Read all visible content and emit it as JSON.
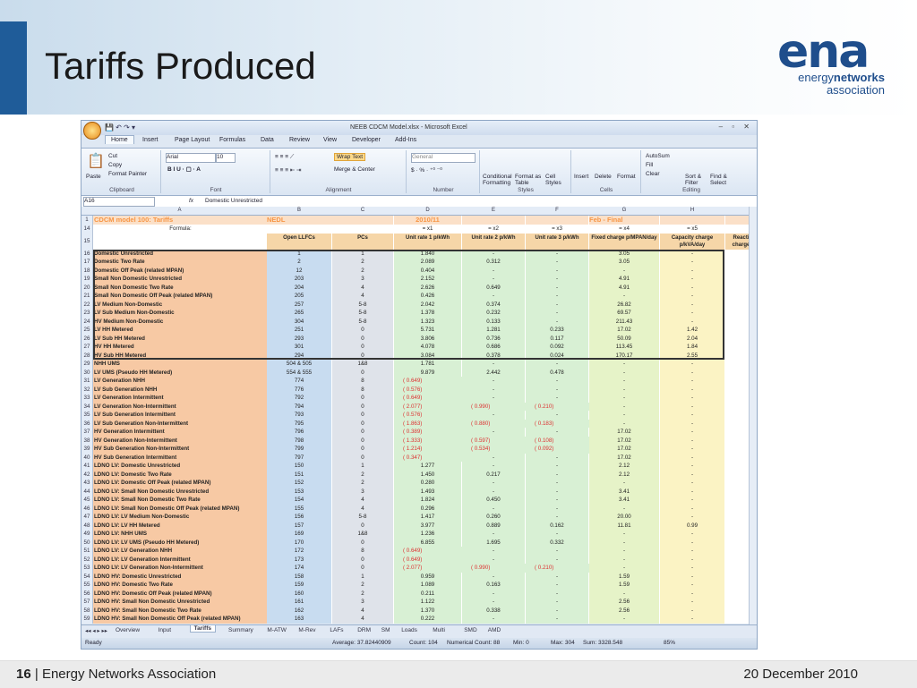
{
  "slide": {
    "title": "Tariffs Produced",
    "logo_big": "ena",
    "logo_line1a": "energy",
    "logo_line1b": "networks",
    "logo_line2": "association",
    "footer_page": "16",
    "footer_sep": "|",
    "footer_org": "Energy Networks Association",
    "footer_date": "20 December 2010"
  },
  "excel": {
    "window_title": "NEEB CDCM Model.xlsx - Microsoft Excel",
    "tabs": [
      "Home",
      "Insert",
      "Page Layout",
      "Formulas",
      "Data",
      "Review",
      "View",
      "Developer",
      "Add-Ins"
    ],
    "ribbon": {
      "clipboard": {
        "paste": "Paste",
        "cut": "Cut",
        "copy": "Copy",
        "format_painter": "Format Painter",
        "label": "Clipboard"
      },
      "font": {
        "name": "Arial",
        "size": "10",
        "label": "Font"
      },
      "alignment": {
        "wrap": "Wrap Text",
        "merge": "Merge & Center",
        "label": "Alignment"
      },
      "number": {
        "format": "General",
        "label": "Number"
      },
      "styles": {
        "cond": "Conditional Formatting",
        "table": "Format as Table",
        "cell": "Cell Styles",
        "label": "Styles"
      },
      "cells": {
        "insert": "Insert",
        "delete": "Delete",
        "format": "Format",
        "label": "Cells"
      },
      "editing": {
        "autosum": "AutoSum",
        "fill": "Fill",
        "clear": "Clear",
        "sort": "Sort & Filter",
        "find": "Find & Select",
        "label": "Editing"
      }
    },
    "name_box": "A16",
    "fx": "fx",
    "formula_value": "Domestic Unrestricted",
    "col_letters": [
      "A",
      "B",
      "C",
      "D",
      "E",
      "F",
      "G",
      "H"
    ],
    "header_row1": {
      "a": "CDCM model 100: Tariffs",
      "b": "NEDL",
      "d": "2010/11",
      "g": "Feb - Final"
    },
    "header_row14": {
      "a": "Formula:",
      "d": "= x1",
      "e": "= x2",
      "f": "= x3",
      "g": "= x4",
      "h": "= x5"
    },
    "header_row15": {
      "b": "Open LLFCs",
      "c": "PCs",
      "d": "Unit rate 1 p/kWh",
      "e": "Unit rate 2 p/kWh",
      "f": "Unit rate 3 p/kWh",
      "g": "Fixed charge p/MPAN/day",
      "h": "Capacity charge p/kVA/day",
      "i": "Reacti charge"
    },
    "rows": [
      {
        "n": "16",
        "a": "Domestic Unrestricted",
        "b": "1",
        "c": "1",
        "d": "1.840",
        "e": "-",
        "f": "-",
        "g": "3.05",
        "h": "-"
      },
      {
        "n": "17",
        "a": "Domestic Two Rate",
        "b": "2",
        "c": "2",
        "d": "2.089",
        "e": "0.312",
        "f": "-",
        "g": "3.05",
        "h": "-"
      },
      {
        "n": "18",
        "a": "Domestic Off Peak (related MPAN)",
        "b": "12",
        "c": "2",
        "d": "0.404",
        "e": "-",
        "f": "-",
        "g": "-",
        "h": "-"
      },
      {
        "n": "19",
        "a": "Small Non Domestic Unrestricted",
        "b": "203",
        "c": "3",
        "d": "2.152",
        "e": "-",
        "f": "-",
        "g": "4.91",
        "h": "-"
      },
      {
        "n": "20",
        "a": "Small Non Domestic Two Rate",
        "b": "204",
        "c": "4",
        "d": "2.626",
        "e": "0.649",
        "f": "-",
        "g": "4.91",
        "h": "-"
      },
      {
        "n": "21",
        "a": "Small Non Domestic Off Peak (related MPAN)",
        "b": "205",
        "c": "4",
        "d": "0.426",
        "e": "-",
        "f": "-",
        "g": "-",
        "h": "-"
      },
      {
        "n": "22",
        "a": "LV Medium Non-Domestic",
        "b": "257",
        "c": "5-8",
        "d": "2.042",
        "e": "0.374",
        "f": "-",
        "g": "26.82",
        "h": "-"
      },
      {
        "n": "23",
        "a": "LV Sub Medium Non-Domestic",
        "b": "265",
        "c": "5-8",
        "d": "1.378",
        "e": "0.232",
        "f": "-",
        "g": "69.57",
        "h": "-"
      },
      {
        "n": "24",
        "a": "HV Medium Non-Domestic",
        "b": "304",
        "c": "5-8",
        "d": "1.323",
        "e": "0.133",
        "f": "-",
        "g": "211.43",
        "h": "-"
      },
      {
        "n": "25",
        "a": "LV HH Metered",
        "b": "251",
        "c": "0",
        "d": "5.731",
        "e": "1.281",
        "f": "0.233",
        "g": "17.02",
        "h": "1.42"
      },
      {
        "n": "26",
        "a": "LV Sub HH Metered",
        "b": "293",
        "c": "0",
        "d": "3.806",
        "e": "0.736",
        "f": "0.117",
        "g": "50.09",
        "h": "2.04"
      },
      {
        "n": "27",
        "a": "HV HH Metered",
        "b": "301",
        "c": "0",
        "d": "4.078",
        "e": "0.686",
        "f": "0.092",
        "g": "113.45",
        "h": "1.84"
      },
      {
        "n": "28",
        "a": "HV Sub HH Metered",
        "b": "294",
        "c": "0",
        "d": "3.084",
        "e": "0.378",
        "f": "0.024",
        "g": "170.17",
        "h": "2.55"
      },
      {
        "n": "29",
        "a": "NHH UMS",
        "b": "504 & 505",
        "c": "1&8",
        "d": "1.781",
        "e": "-",
        "f": "-",
        "g": "-",
        "h": "-"
      },
      {
        "n": "30",
        "a": "LV UMS (Pseudo HH Metered)",
        "b": "554 & 555",
        "c": "0",
        "d": "9.879",
        "e": "2.442",
        "f": "0.478",
        "g": "-",
        "h": "-"
      },
      {
        "n": "31",
        "a": "LV Generation NHH",
        "b": "774",
        "c": "8",
        "d": "(      0.649)",
        "e": "-",
        "f": "-",
        "g": "-",
        "h": "-",
        "neg": "d"
      },
      {
        "n": "32",
        "a": "LV Sub Generation NHH",
        "b": "776",
        "c": "8",
        "d": "(      0.576)",
        "e": "-",
        "f": "-",
        "g": "-",
        "h": "-",
        "neg": "d"
      },
      {
        "n": "33",
        "a": "LV Generation Intermittent",
        "b": "792",
        "c": "0",
        "d": "(      0.649)",
        "e": "-",
        "f": "-",
        "g": "-",
        "h": "-",
        "neg": "d"
      },
      {
        "n": "34",
        "a": "LV Generation Non-Intermittent",
        "b": "794",
        "c": "0",
        "d": "(      2.077)",
        "e": "(      0.990)",
        "f": "(      0.210)",
        "g": "-",
        "h": "-",
        "neg": "def"
      },
      {
        "n": "35",
        "a": "LV Sub Generation Intermittent",
        "b": "793",
        "c": "0",
        "d": "(      0.576)",
        "e": "-",
        "f": "-",
        "g": "-",
        "h": "-",
        "neg": "d"
      },
      {
        "n": "36",
        "a": "LV Sub Generation Non-Intermittent",
        "b": "795",
        "c": "0",
        "d": "(      1.863)",
        "e": "(      0.880)",
        "f": "(      0.183)",
        "g": "-",
        "h": "-",
        "neg": "def"
      },
      {
        "n": "37",
        "a": "HV Generation Intermittent",
        "b": "796",
        "c": "0",
        "d": "(      0.389)",
        "e": "-",
        "f": "-",
        "g": "17.02",
        "h": "-",
        "neg": "d"
      },
      {
        "n": "38",
        "a": "HV Generation Non-Intermittent",
        "b": "798",
        "c": "0",
        "d": "(      1.333)",
        "e": "(      0.597)",
        "f": "(      0.108)",
        "g": "17.02",
        "h": "-",
        "neg": "def"
      },
      {
        "n": "39",
        "a": "HV Sub Generation Non-Intermittent",
        "b": "799",
        "c": "0",
        "d": "(      1.214)",
        "e": "(      0.534)",
        "f": "(      0.092)",
        "g": "17.02",
        "h": "-",
        "neg": "def"
      },
      {
        "n": "40",
        "a": "HV Sub Generation Intermittent",
        "b": "797",
        "c": "0",
        "d": "(      0.347)",
        "e": "-",
        "f": "-",
        "g": "17.02",
        "h": "-",
        "neg": "d"
      },
      {
        "n": "41",
        "a": "LDNO LV: Domestic Unrestricted",
        "b": "150",
        "c": "1",
        "d": "1.277",
        "e": "-",
        "f": "-",
        "g": "2.12",
        "h": "-"
      },
      {
        "n": "42",
        "a": "LDNO LV: Domestic Two Rate",
        "b": "151",
        "c": "2",
        "d": "1.450",
        "e": "0.217",
        "f": "-",
        "g": "2.12",
        "h": "-"
      },
      {
        "n": "43",
        "a": "LDNO LV: Domestic Off Peak (related MPAN)",
        "b": "152",
        "c": "2",
        "d": "0.280",
        "e": "-",
        "f": "-",
        "g": "-",
        "h": "-"
      },
      {
        "n": "44",
        "a": "LDNO LV: Small Non Domestic Unrestricted",
        "b": "153",
        "c": "3",
        "d": "1.493",
        "e": "-",
        "f": "-",
        "g": "3.41",
        "h": "-"
      },
      {
        "n": "45",
        "a": "LDNO LV: Small Non Domestic Two Rate",
        "b": "154",
        "c": "4",
        "d": "1.824",
        "e": "0.450",
        "f": "-",
        "g": "3.41",
        "h": "-"
      },
      {
        "n": "46",
        "a": "LDNO LV: Small Non Domestic Off Peak (related MPAN)",
        "b": "155",
        "c": "4",
        "d": "0.296",
        "e": "-",
        "f": "-",
        "g": "-",
        "h": "-"
      },
      {
        "n": "47",
        "a": "LDNO LV: LV Medium Non-Domestic",
        "b": "156",
        "c": "5-8",
        "d": "1.417",
        "e": "0.260",
        "f": "-",
        "g": "20.00",
        "h": "-"
      },
      {
        "n": "48",
        "a": "LDNO LV: LV HH Metered",
        "b": "157",
        "c": "0",
        "d": "3.977",
        "e": "0.889",
        "f": "0.162",
        "g": "11.81",
        "h": "0.99"
      },
      {
        "n": "49",
        "a": "LDNO LV: NHH UMS",
        "b": "169",
        "c": "1&8",
        "d": "1.236",
        "e": "-",
        "f": "-",
        "g": "-",
        "h": "-"
      },
      {
        "n": "50",
        "a": "LDNO LV: LV UMS (Pseudo HH Metered)",
        "b": "170",
        "c": "0",
        "d": "6.855",
        "e": "1.695",
        "f": "0.332",
        "g": "-",
        "h": "-"
      },
      {
        "n": "51",
        "a": "LDNO LV: LV Generation NHH",
        "b": "172",
        "c": "8",
        "d": "(      0.649)",
        "e": "-",
        "f": "-",
        "g": "-",
        "h": "-",
        "neg": "d"
      },
      {
        "n": "52",
        "a": "LDNO LV: LV Generation Intermittent",
        "b": "173",
        "c": "0",
        "d": "(      0.649)",
        "e": "-",
        "f": "-",
        "g": "-",
        "h": "-",
        "neg": "d"
      },
      {
        "n": "53",
        "a": "LDNO LV: LV Generation Non-Intermittent",
        "b": "174",
        "c": "0",
        "d": "(      2.077)",
        "e": "(      0.990)",
        "f": "(      0.210)",
        "g": "-",
        "h": "-",
        "neg": "def"
      },
      {
        "n": "54",
        "a": "LDNO HV: Domestic Unrestricted",
        "b": "158",
        "c": "1",
        "d": "0.959",
        "e": "-",
        "f": "-",
        "g": "1.59",
        "h": "-"
      },
      {
        "n": "55",
        "a": "LDNO HV: Domestic Two Rate",
        "b": "159",
        "c": "2",
        "d": "1.089",
        "e": "0.163",
        "f": "-",
        "g": "1.59",
        "h": "-"
      },
      {
        "n": "56",
        "a": "LDNO HV: Domestic Off Peak (related MPAN)",
        "b": "160",
        "c": "2",
        "d": "0.211",
        "e": "-",
        "f": "-",
        "g": "-",
        "h": "-"
      },
      {
        "n": "57",
        "a": "LDNO HV: Small Non Domestic Unrestricted",
        "b": "161",
        "c": "3",
        "d": "1.122",
        "e": "-",
        "f": "-",
        "g": "2.56",
        "h": "-"
      },
      {
        "n": "58",
        "a": "LDNO HV: Small Non Domestic Two Rate",
        "b": "162",
        "c": "4",
        "d": "1.370",
        "e": "0.338",
        "f": "-",
        "g": "2.56",
        "h": "-"
      },
      {
        "n": "59",
        "a": "LDNO HV: Small Non Domestic Off Peak (related MPAN)",
        "b": "163",
        "c": "4",
        "d": "0.222",
        "e": "-",
        "f": "-",
        "g": "-",
        "h": "-"
      }
    ],
    "sheet_tabs": [
      "Overview",
      "Input",
      "Tariffs",
      "Summary",
      "M-ATW",
      "M-Rev",
      "LAFs",
      "DRM",
      "SM",
      "Loads",
      "Multi",
      "SMD",
      "AMD"
    ],
    "active_sheet": "Tariffs",
    "status": {
      "ready": "Ready",
      "average": "Average: 37.82440909",
      "count": "Count: 104",
      "numerical_count": "Numerical Count: 88",
      "min": "Min: 0",
      "max": "Max: 304",
      "sum": "Sum: 3328.548",
      "zoom": "85%"
    },
    "colors": {
      "name_col": "#f7c9a4",
      "llfc_col": "#c8dcf0",
      "pc_col": "#dfe3ea",
      "unit_col": "#d8f0d4",
      "fixed_col": "#e6f3c8",
      "cap_col": "#fbf3c4",
      "header_orange": "#f79646"
    }
  }
}
